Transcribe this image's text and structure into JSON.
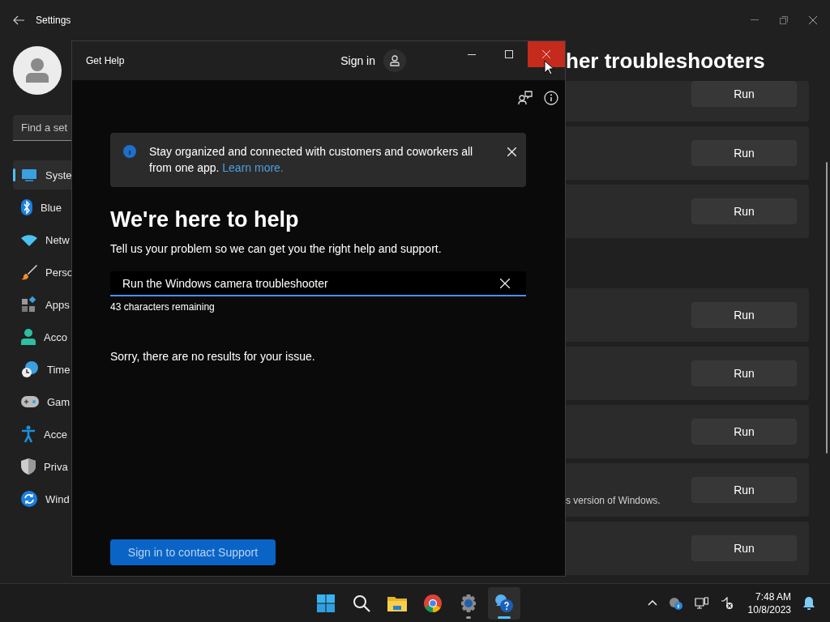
{
  "settings_window": {
    "title": "Settings",
    "search": {
      "placeholder": "Find a set"
    },
    "nav_items": [
      {
        "kind": "system",
        "label": "Syste",
        "selected": true
      },
      {
        "kind": "bluetooth",
        "label": "Blue",
        "selected": false
      },
      {
        "kind": "network",
        "label": "Netw",
        "selected": false
      },
      {
        "kind": "personalization",
        "label": "Perso",
        "selected": false
      },
      {
        "kind": "apps",
        "label": "Apps",
        "selected": false
      },
      {
        "kind": "accounts",
        "label": "Acco",
        "selected": false
      },
      {
        "kind": "time",
        "label": "Time",
        "selected": false
      },
      {
        "kind": "gaming",
        "label": "Gam",
        "selected": false
      },
      {
        "kind": "accessibility",
        "label": "Acce",
        "selected": false
      },
      {
        "kind": "privacy",
        "label": "Priva",
        "selected": false
      },
      {
        "kind": "update",
        "label": "Wind",
        "selected": false
      }
    ],
    "heading": "her troubleshooters",
    "groups": [
      {
        "items": [
          {
            "button": "Run"
          },
          {
            "button": "Run"
          },
          {
            "button": "Run"
          }
        ]
      },
      {
        "items": [
          {
            "button": "Run"
          },
          {
            "button": "Run"
          },
          {
            "button": "Run"
          },
          {
            "button": "Run",
            "description": "s version of Windows."
          },
          {
            "button": "Run"
          }
        ]
      }
    ]
  },
  "help_window": {
    "title": "Get Help",
    "sign_in": "Sign in",
    "banner": {
      "text": "Stay organized and connected with customers and coworkers all from one app.",
      "link": "Learn more."
    },
    "heading": "We're here to help",
    "subheading": "Tell us your problem so we can get you the right help and support.",
    "query": {
      "value": "Run the Windows camera troubleshooter",
      "remaining": "43 characters remaining"
    },
    "message": "Sorry, there are no results for your issue.",
    "button": "Sign in to contact Support"
  },
  "taskbar": {
    "apps": [
      {
        "kind": "start",
        "selected": false,
        "running": false
      },
      {
        "kind": "search",
        "selected": false,
        "running": false
      },
      {
        "kind": "files",
        "selected": false,
        "running": false
      },
      {
        "kind": "browser",
        "selected": false,
        "running": false
      },
      {
        "kind": "settings",
        "selected": false,
        "running": true
      },
      {
        "kind": "help",
        "selected": true,
        "running": true
      }
    ],
    "time": "7:48 AM",
    "date": "10/8/2023"
  }
}
